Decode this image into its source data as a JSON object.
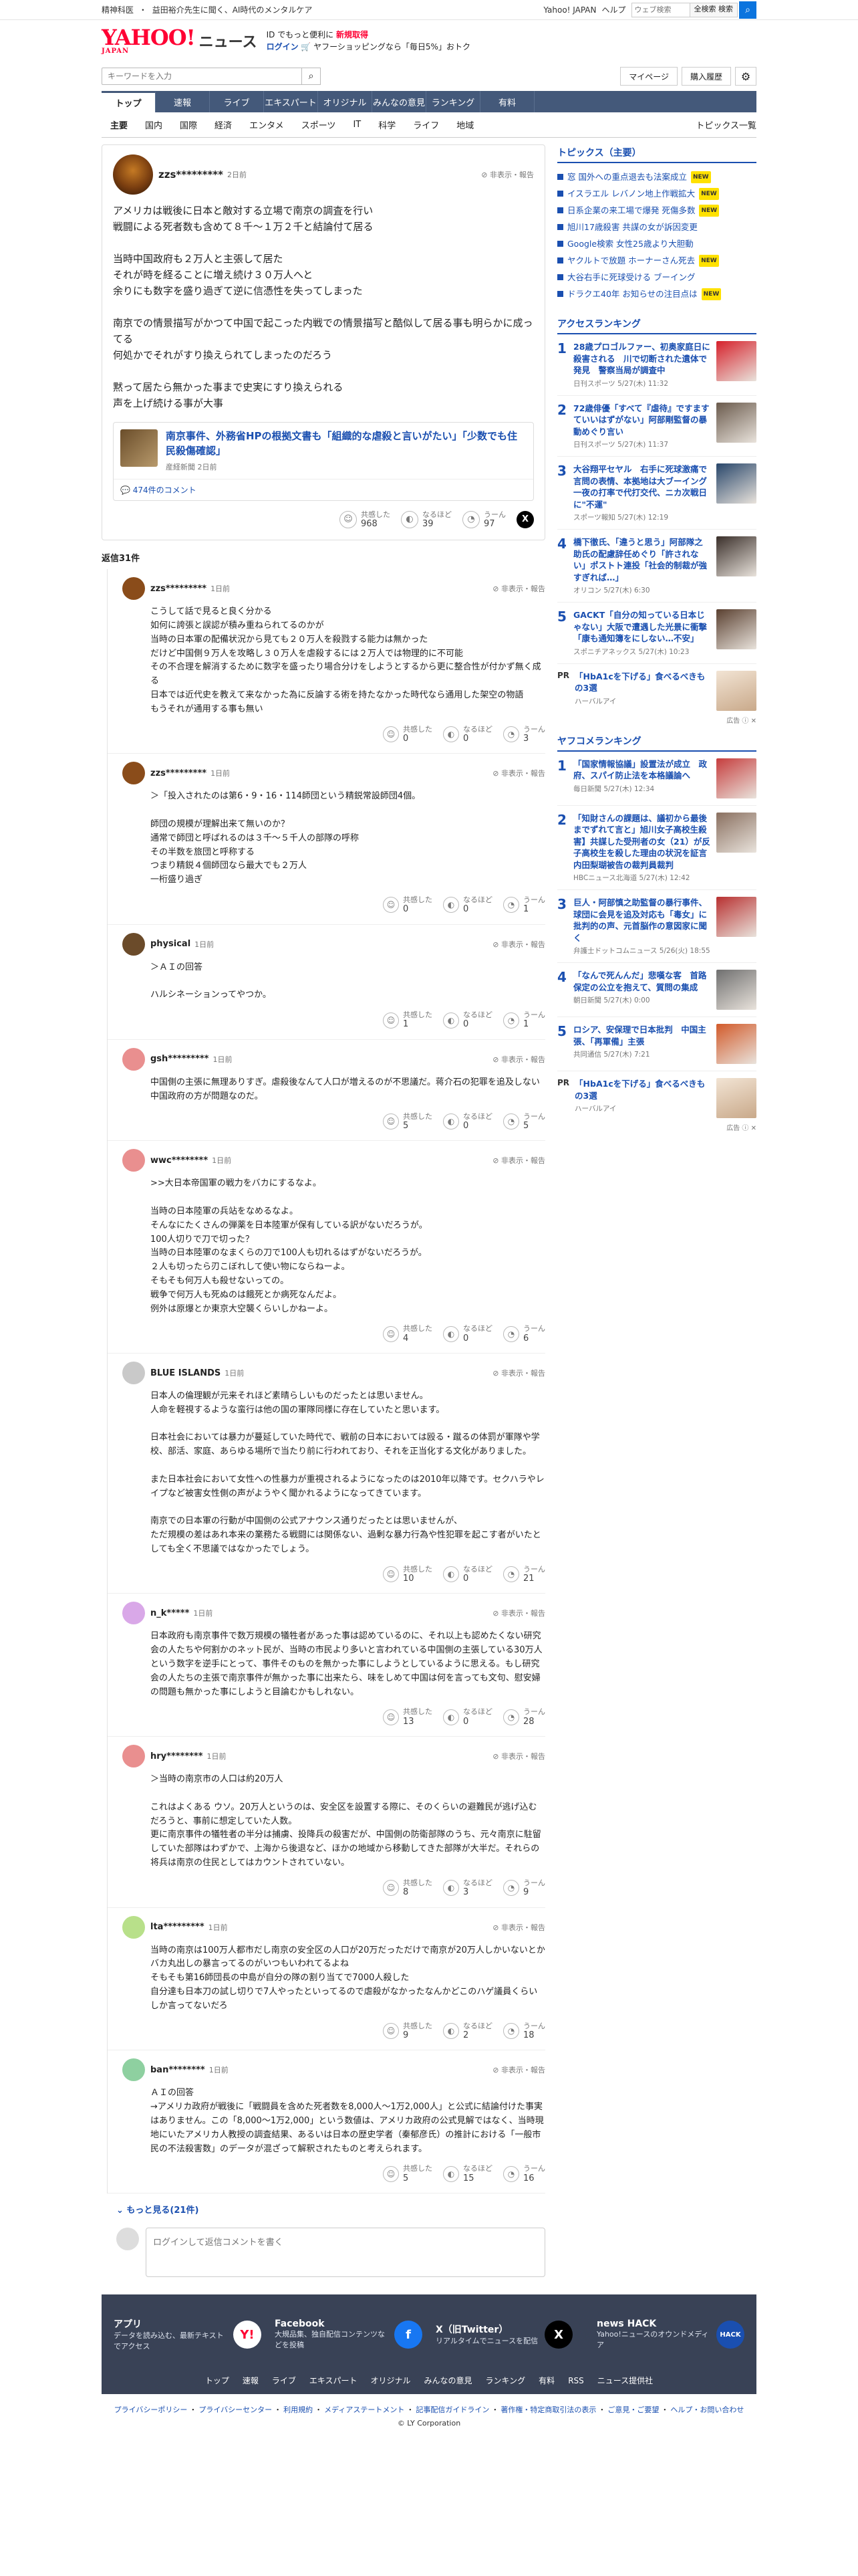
{
  "topstrip": {
    "links": [
      "精神科医",
      "・",
      "益田裕介先生に聞く、AI時代のメンタルケア"
    ],
    "right": [
      "Yahoo! JAPAN",
      "ヘルプ"
    ],
    "search_placeholder": "ウェブ検索",
    "search_btn": "全検索 検索"
  },
  "masthead": {
    "logo": "YAHOO!",
    "logo_sub": "JAPAN",
    "service": "ニュース",
    "promo_line1_a": "ID でもっと便利に",
    "promo_line1_b": "新規取得",
    "promo_login": "ログイン",
    "promo_line2": "🛒 ヤフーショッピングなら「毎日5%」おトク"
  },
  "searchbar": {
    "placeholder": "キーワードを入力",
    "mypage": "マイページ",
    "purchase": "購入履歴"
  },
  "nav": [
    "トップ",
    "速報",
    "ライブ",
    "エキスパート",
    "オリジナル",
    "みんなの意見",
    "ランキング",
    "有料"
  ],
  "subnav": [
    "主要",
    "国内",
    "国際",
    "経済",
    "エンタメ",
    "スポーツ",
    "IT",
    "科学",
    "ライフ",
    "地域"
  ],
  "subnav_right": "トピックス一覧",
  "post": {
    "user": "zzs*********",
    "time": "2日前",
    "report": "非表示・報告",
    "body": "アメリカは戦後に日本と敵対する立場で南京の調査を行い\n戦闘による死者数も含めて８千〜１万２千と結論付て居る\n\n当時中国政府も２万人と主張して居た\nそれが時を経ることに増え続け３０万人へと\n余りにも数字を盛り過ぎて逆に信憑性を失ってしまった\n\n南京での情景描写がかつて中国で起こった内戦での情景描写と酷似して居る事も明らかに成ってる\n何処かでそれがすり換えられてしまったのだろう\n\n黙って居たら無かった事まで史実にすり換えられる\n声を上げ続ける事が大事",
    "card_title": "南京事件、外務省HPの根拠文書も「組織的な虐殺と言いがたい」「少数でも住民殺傷確認」",
    "card_src": "産経新聞 2日前",
    "card_comments": "💬 474件のコメント",
    "r1_label": "共感した",
    "r1": "968",
    "r2_label": "なるほど",
    "r2": "39",
    "r3_label": "うーん",
    "r3": "97"
  },
  "reply_count": "返信31件",
  "replies": [
    {
      "user": "zzs*********",
      "time": "1日前",
      "body": "こうして話で見ると良く分かる\n如何に誇張と誤認が積み重ねられてるのかが\n当時の日本軍の配備状況から見ても２０万人を殺戮する能力は無かった\nだけど中国側９万人を攻略し３０万人を虐殺するには２万人では物理的に不可能\nその不合理を解消するために数字を盛ったり場合分けをしようとするから更に整合性が付かず無く成る\n日本では近代史を教えて来なかった為に反論する術を持たなかった時代なら通用した架空の物語\nもうそれが通用する事も無い",
      "a": "0",
      "b": "0",
      "c": "3",
      "color": "#8a4c1a"
    },
    {
      "user": "zzs*********",
      "time": "1日前",
      "body": "＞「投入されたのは第6・9・16・114師団という精鋭常設師団4個。\n\n師団の規模が理解出来て無いのか？\n通常で師団と呼ばれるのは３千〜５千人の部隊の呼称\nその半数を旅団と呼称する\nつまり精鋭４個師団なら最大でも２万人\n一桁盛り過ぎ",
      "a": "0",
      "b": "0",
      "c": "1",
      "color": "#8a4c1a"
    },
    {
      "user": "physical",
      "time": "1日前",
      "body": "＞ＡＩの回答\n\nハルシネーションってやつか。",
      "a": "1",
      "b": "0",
      "c": "1",
      "color": "#6b4b2a"
    },
    {
      "user": "gsh*********",
      "time": "1日前",
      "body": "中国側の主張に無理ありすぎ。虐殺後なんて人口が増えるのが不思議だ。蒋介石の犯罪を追及しない中国政府の方が問題なのだ。",
      "a": "5",
      "b": "0",
      "c": "5",
      "color": "#e98f8f"
    },
    {
      "user": "wwc********",
      "time": "1日前",
      "body": ">>大日本帝国軍の戦力をバカにするなよ。\n\n当時の日本陸軍の兵站をなめるなよ。\nそんなにたくさんの弾薬を日本陸軍が保有している訳がないだろうが。\n100人切りで刀で切った？\n当時の日本陸軍のなまくらの刀で100人も切れるはずがないだろうが。\n２人も切ったら刃こぼれして使い物にならねーよ。\nそもそも何万人も殺せないっての。\n戦争で何万人も死ぬのは餓死とか病死なんだよ。\n例外は原爆とか東京大空襲くらいしかねーよ。",
      "a": "4",
      "b": "0",
      "c": "6",
      "color": "#e98f8f"
    },
    {
      "user": "BLUE ISLANDS",
      "time": "1日前",
      "body": "日本人の倫理観が元来それほど素晴らしいものだったとは思いません。\n人命を軽視するような蛮行は他の国の軍隊同様に存在していたと思います。\n\n日本社会においては暴力が蔓延していた時代で、戦前の日本においては殴る・蹴るの体罰が軍隊や学校、部活、家庭、あらゆる場所で当たり前に行われており、それを正当化する文化がありました。\n\nまた日本社会において女性への性暴力が重視されるようになったのは2010年以降です。セクハラやレイプなど被害女性側の声がようやく聞かれるようになってきています。\n\n南京での日本軍の行動が中国側の公式アナウンス通りだったとは思いませんが、\nただ規模の差はあれ本来の業務たる戦闘には関係ない、過剰な暴力行為や性犯罪を起こす者がいたとしても全く不思議ではなかったでしょう。",
      "a": "10",
      "b": "0",
      "c": "21",
      "color": "#c9c9c9"
    },
    {
      "user": "n_k*****",
      "time": "1日前",
      "body": "日本政府も南京事件で数万規模の犠牲者があった事は認めているのに、それ以上も認めたくない研究会の人たちや何割かのネット民が、当時の市民より多いと言われている中国側の主張している30万人という数字を逆手にとって、事件そのものを無かった事にしようとしているように思える。もし研究会の人たちの主張で南京事件が無かった事に出来たら、味をしめて中国は何を言っても文句、慰安婦の問題も無かった事にしようと目論むかもしれない。",
      "a": "13",
      "b": "0",
      "c": "28",
      "color": "#d9a8e8"
    },
    {
      "user": "hry********",
      "time": "1日前",
      "body": "＞当時の南京市の人口は約20万人\n\nこれはよくある ウソ。20万人というのは、安全区を設置する際に、そのくらいの避難民が逃げ込むだろうと、事前に想定していた人数。\n更に南京事件の犠牲者の半分は捕虜、投降兵の殺害だが、中国側の防衛部隊のうち、元々南京に駐留していた部隊はわずかで、上海から後退など、ほかの地域から移動してきた部隊が大半だ。それらの将兵は南京の住民としてはカウントされていない。",
      "a": "8",
      "b": "3",
      "c": "9",
      "color": "#e98f8f"
    },
    {
      "user": "lta*********",
      "time": "1日前",
      "body": "当時の南京は100万人都市だし南京の安全区の人口が20万だっただけで南京が20万人しかいないとかバカ丸出しの暴言ってるのがいつもいわれてるよね\nそもそも第16師団長の中島が自分の隊の割り当てで7000人殺した\n自分達も日本刀の試し切りで7人やったといってるので虐殺がなかったなんかどこのハゲ議員くらいしか言ってないだろ",
      "a": "9",
      "b": "2",
      "c": "18",
      "color": "#b8e08a"
    },
    {
      "user": "ban********",
      "time": "1日前",
      "body": "ＡＩの回答\n→アメリカ政府が戦後に「戦闘員を含めた死者数を8,000人〜1万2,000人」と公式に結論付けた事実はありません。この「8,000〜1万2,000」という数値は、アメリカ政府の公式見解ではなく、当時現地にいたアメリカ人教授の調査結果、あるいは日本の歴史学者（秦郁彦氏）の推計における「一般市民の不法殺害数」のデータが混ざって解釈されたものと考えられます。",
      "a": "5",
      "b": "15",
      "c": "16",
      "color": "#8ed0a0"
    }
  ],
  "more": "もっと見る(21件)",
  "comment_placeholder": "ログインして返信コメントを書く",
  "side": {
    "topics_head": "トピックス（主要）",
    "topics": [
      {
        "t": "窓 国外への重点退去も法案成立",
        "new": true
      },
      {
        "t": "イスラエル レバノン地上作戦拡大",
        "new": true
      },
      {
        "t": "日系企業の来工場で爆発 死傷多数",
        "new": true
      },
      {
        "t": "旭川17歳殺害 共謀の女が訴因変更",
        "new": false
      },
      {
        "t": "Google検索 女性25歳より大胆動",
        "new": false
      },
      {
        "t": "ヤクルトで放題 ホーナーさん死去",
        "new": true
      },
      {
        "t": "大谷右手に死球受ける ブーイング",
        "new": false
      },
      {
        "t": "ドラクエ40年 お知らせの注目点は",
        "new": true
      }
    ],
    "new_label": "NEW",
    "access_head": "アクセスランキング",
    "access": [
      {
        "n": "1",
        "t": "28歳プロゴルファー、初奥家庭日に殺害される　川で切断された遺体で発見　警察当局が調査中",
        "s": "日刊スポーツ 5/27(木) 11:32",
        "c": "#d6212b"
      },
      {
        "n": "2",
        "t": "72歳俳優「すべて『虐待』ですますていいはずがない」阿部剛監督の暴動めぐり言い",
        "s": "日刊スポーツ 5/27(木) 11:37",
        "c": "#6a5a4c"
      },
      {
        "n": "3",
        "t": "大谷翔平セヤル　右手に死球激痛で言問の表情、本拠地は大ブーイング一夜の打率で代打交代、ニカ次戦日に\"不運\"",
        "s": "スポーツ報知 5/27(木) 12:19",
        "c": "#28466a"
      },
      {
        "n": "4",
        "t": "橋下徹氏、「違うと思う」阿部隊之助氏の配慮辞任めぐり「許されない」ポストト連投「社会的制裁が強すぎれば…」",
        "s": "オリコン 5/27(木) 6:30",
        "c": "#3a2f2a"
      },
      {
        "n": "5",
        "t": "GACKT「自分の知っている日本じゃない」大阪で遭遇した光景に衝撃「康も通知簿をにしない…不安」",
        "s": "スポニチアネックス 5/27(木) 10:23",
        "c": "#5a4030"
      }
    ],
    "pr_tag": "PR",
    "pr1_title": "「HbA1cを下げる」食べるべきもの3選",
    "pr1_src": "ハーバルアイ",
    "ad": "広告 ⓘ ✕",
    "yahoo_head": "ヤフコメランキング",
    "yahoo": [
      {
        "n": "1",
        "t": "「国家情報協議」設置法が成立　政府、スパイ防止法を本格議論へ",
        "s": "毎日新聞 5/27(木) 12:34",
        "c": "#c63d3d"
      },
      {
        "n": "2",
        "t": "「知財さんの課題は、議初から最後までずれて言と」旭川女子高校生殺害】共謀した受刑者の女（21）が反子高校生を殺した理由の状況を証言　内田梨瑚被告の裁判員裁判",
        "s": "HBCニュース北海道 5/27(木) 12:42",
        "c": "#8a7060"
      },
      {
        "n": "3",
        "t": "巨人・阿部慎之助監督の暴行事件、球団に会見を追及対応も「毒女」に批判的の声、元首脳作の意図家に聞く",
        "s": "弁護士ドットコムニュース 5/26(火) 18:55",
        "c": "#b83030"
      },
      {
        "n": "4",
        "t": "「なんで死んんだ」悲嘆な客　首路保定の公立を抱えて、質問の集成",
        "s": "朝日新聞 5/27(木) 0:00",
        "c": "#6f6f6f"
      },
      {
        "n": "5",
        "t": "ロシア、安保理で日本批判　中国主張、「再軍備」主張",
        "s": "共同通信 5/27(木) 7:21",
        "c": "#d25a2a"
      }
    ],
    "pr2_title": "「HbA1cを下げる」食べるべきもの3選",
    "pr2_src": "ハーバルアイ"
  },
  "footer": {
    "items": [
      {
        "t": "アプリ",
        "d": "データを読み込む、最新テキストでアクセス",
        "icon": "Y!",
        "bg": "#ffffff",
        "fg": "#ff0033"
      },
      {
        "t": "Facebook",
        "d": "大規品集、独自配信コンテンツなどを投稿",
        "icon": "f",
        "bg": "#1877f2",
        "fg": "#ffffff"
      },
      {
        "t": "X（旧Twitter）",
        "d": "リアルタイムでニュースを配信",
        "icon": "X",
        "bg": "#000000",
        "fg": "#ffffff"
      },
      {
        "t": "news HACK",
        "d": "Yahoo!ニュースのオウンドメディア",
        "icon": "HACK",
        "bg": "#1a4fb0",
        "fg": "#ffffff"
      }
    ],
    "links": [
      "トップ",
      "速報",
      "ライブ",
      "エキスパート",
      "オリジナル",
      "みんなの意見",
      "ランキング",
      "有料",
      "RSS",
      "ニュース提供社"
    ],
    "legal": [
      "プライバシーポリシー",
      "プライバシーセンター",
      "利用規約",
      "メディアステートメント",
      "記事配信ガイドライン",
      "著作権・特定商取引法の表示",
      "ご意見・ご要望",
      "ヘルプ・お問い合わせ"
    ],
    "copy": "© LY Corporation"
  }
}
